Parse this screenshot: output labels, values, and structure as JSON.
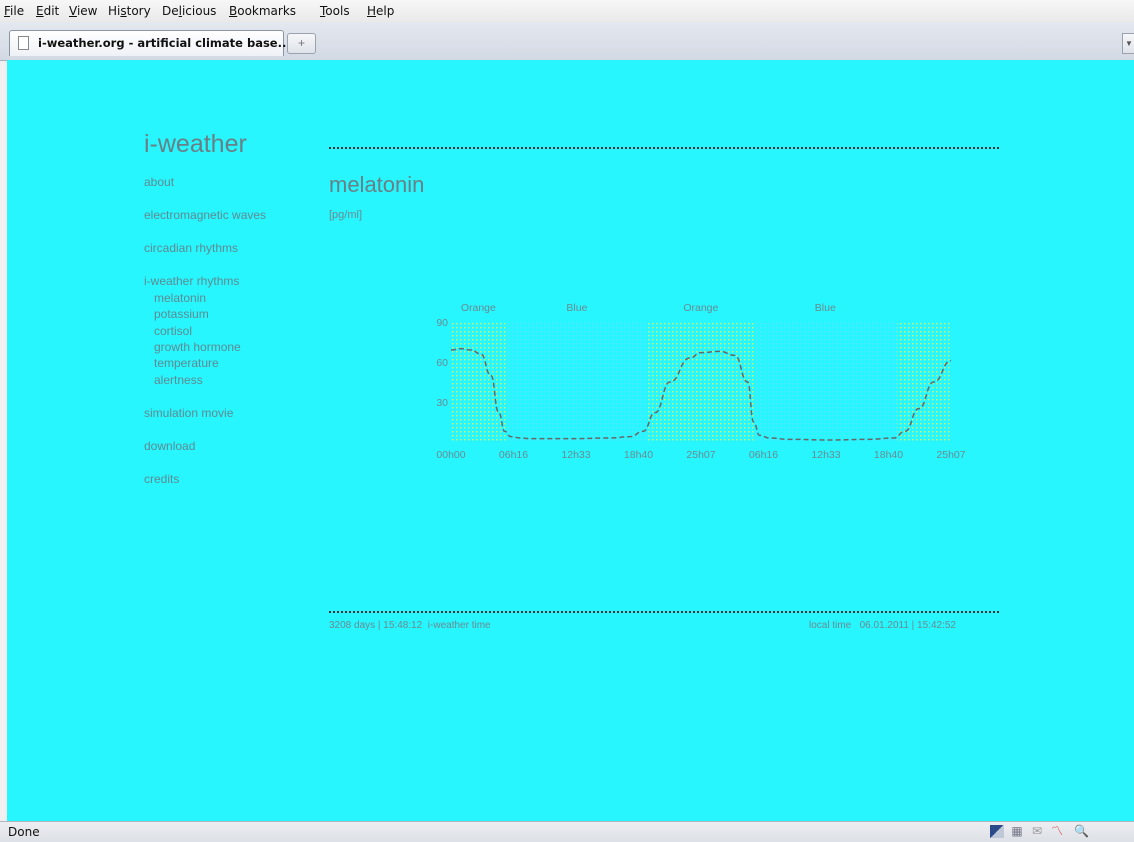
{
  "menu": [
    {
      "pre": "",
      "key": "F",
      "post": "ile"
    },
    {
      "pre": "",
      "key": "E",
      "post": "dit"
    },
    {
      "pre": "",
      "key": "V",
      "post": "iew"
    },
    {
      "pre": "Hi",
      "key": "s",
      "post": "tory"
    },
    {
      "pre": "De",
      "key": "l",
      "post": "icious"
    },
    {
      "pre": "",
      "key": "B",
      "post": "ookmarks"
    },
    {
      "pre": "",
      "key": "T",
      "post": "ools"
    },
    {
      "pre": "",
      "key": "H",
      "post": "elp"
    }
  ],
  "tab": {
    "title": "i-weather.org - artificial climate base..."
  },
  "newtab_symbol": "+",
  "site": {
    "title": "i-weather"
  },
  "nav": {
    "about": "about",
    "electromagnetic": "electromagnetic waves",
    "circadian": "circadian rhythms",
    "rhythms": "i-weather rhythms",
    "sub": [
      "melatonin",
      "potassium",
      "cortisol",
      "growth hormone",
      "temperature",
      "alertness"
    ],
    "simulation": "simulation movie",
    "download": "download",
    "credits": "credits"
  },
  "page": {
    "title": "melatonin",
    "unit": "[pg/ml]"
  },
  "chart_data": {
    "type": "line",
    "title": "",
    "ylabel": "",
    "xlabel": "",
    "ylim": [
      0,
      90
    ],
    "yticks": [
      30,
      60,
      90
    ],
    "xtick_labels": [
      "00h00",
      "06h16",
      "12h33",
      "18h40",
      "25h07",
      "06h16",
      "12h33",
      "18h40",
      "25h07"
    ],
    "x_range": [
      0,
      50.23
    ],
    "phases": [
      {
        "label": "Orange",
        "start": 0,
        "end": 5.5,
        "color": "#e0f05a"
      },
      {
        "label": "Blue",
        "start": 5.5,
        "end": 19.8,
        "color": "#8fd0ff"
      },
      {
        "label": "Orange",
        "start": 19.8,
        "end": 30.4,
        "color": "#e0f05a"
      },
      {
        "label": "Blue",
        "start": 30.4,
        "end": 44.8,
        "color": "#8fd0ff"
      },
      {
        "label": "",
        "start": 44.8,
        "end": 50.23,
        "color": "#e0f05a"
      }
    ],
    "series": [
      {
        "x": [
          0,
          1,
          2,
          3,
          4,
          4.8,
          5.4,
          6,
          7,
          8,
          12,
          16,
          18,
          19.3,
          20.5,
          22,
          24,
          25.1,
          27,
          28.5,
          29.8,
          30.4,
          31,
          32,
          34,
          38,
          42,
          44.5,
          45.6,
          47,
          48.5,
          50.23
        ],
        "y": [
          69,
          70,
          69,
          66,
          50,
          22,
          8,
          4,
          3,
          2.5,
          2.5,
          3,
          4,
          8,
          22,
          45,
          63,
          67,
          68,
          65,
          45,
          15,
          5,
          3,
          2,
          1.5,
          2,
          3,
          8,
          25,
          45,
          61
        ],
        "color": "#666666",
        "style": "dashed"
      }
    ]
  },
  "footer": {
    "days": "3208 days | 15:48:12",
    "iw_label": "i-weather time",
    "local_label": "local time",
    "local_value": "06.01.2011 | 15:42:52"
  },
  "status": {
    "text": "Done"
  },
  "colors": {
    "page_bg": "#27f6ff",
    "text": "#6a8a90"
  }
}
